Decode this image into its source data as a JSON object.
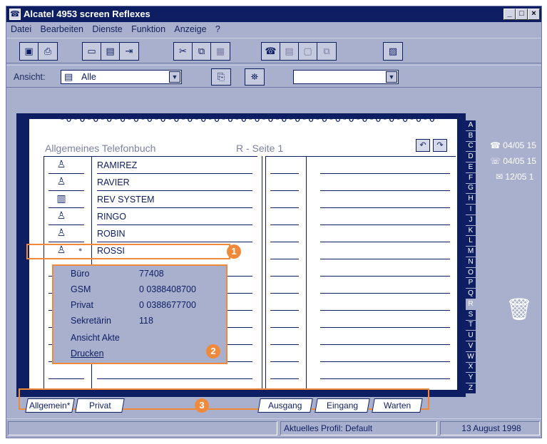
{
  "window": {
    "title": "Alcatel 4953 screen Reflexes"
  },
  "menu": [
    "Datei",
    "Bearbeiten",
    "Dienste",
    "Funktion",
    "Anzeige",
    "?"
  ],
  "toolbar": {
    "icons": [
      "save-icon",
      "print-icon",
      "dial-icon",
      "memo-icon",
      "exit-icon",
      "cut-icon",
      "copy-icon",
      "paste-icon",
      "phone-icon",
      "fax-icon",
      "card-icon",
      "transfer-icon",
      "properties-icon"
    ]
  },
  "viewbar": {
    "label": "Ansicht:",
    "selected": "Alle",
    "second_value": ""
  },
  "phonebook": {
    "title": "Allgemeines Telefonbuch",
    "page_label": "R - Seite 1",
    "rings": "-0-0-0-0-0-0-0-0-0-0-0-0-0-0-0-0-0-0-0-0-0-0-0-0-0-0-0-0",
    "entries": [
      {
        "name": "RAMIREZ",
        "icon": "person-icon"
      },
      {
        "name": "RAVIER",
        "icon": "person-icon"
      },
      {
        "name": "REV SYSTEM",
        "icon": "company-icon"
      },
      {
        "name": "RINGO",
        "icon": "person-icon"
      },
      {
        "name": "ROBIN",
        "icon": "person-icon"
      },
      {
        "name": "ROSSI",
        "icon": "person-icon"
      }
    ],
    "letters": [
      "A",
      "B",
      "C",
      "D",
      "E",
      "F",
      "G",
      "H",
      "I",
      "J",
      "K",
      "L",
      "M",
      "N",
      "O",
      "P",
      "Q",
      "R",
      "S",
      "T",
      "U",
      "V",
      "W",
      "X",
      "Y",
      "Z"
    ],
    "selected_letter": "R"
  },
  "popup": {
    "items": [
      {
        "label": "Büro",
        "value": "77408"
      },
      {
        "label": "GSM",
        "value": "0 0388408700"
      },
      {
        "label": "Privat",
        "value": "0 0388677700"
      },
      {
        "label": "Sekretärin",
        "value": "118"
      },
      {
        "label": "Ansicht Akte",
        "value": ""
      },
      {
        "label": "Drucken",
        "value": ""
      }
    ]
  },
  "badges": [
    "1",
    "2",
    "3"
  ],
  "tabs": {
    "left": [
      "Allgemein*",
      "Privat"
    ],
    "right": [
      "Ausgang",
      "Eingang",
      "Warten"
    ]
  },
  "calls": [
    "04/05 15",
    "04/05 15",
    "12/05 1"
  ],
  "status": {
    "profile": "Aktuelles Profil: Default",
    "date": "13 August 1998"
  },
  "colors": {
    "navy": "#0d1e63",
    "panel": "#a9b0ce",
    "highlight": "#f08a3a"
  }
}
